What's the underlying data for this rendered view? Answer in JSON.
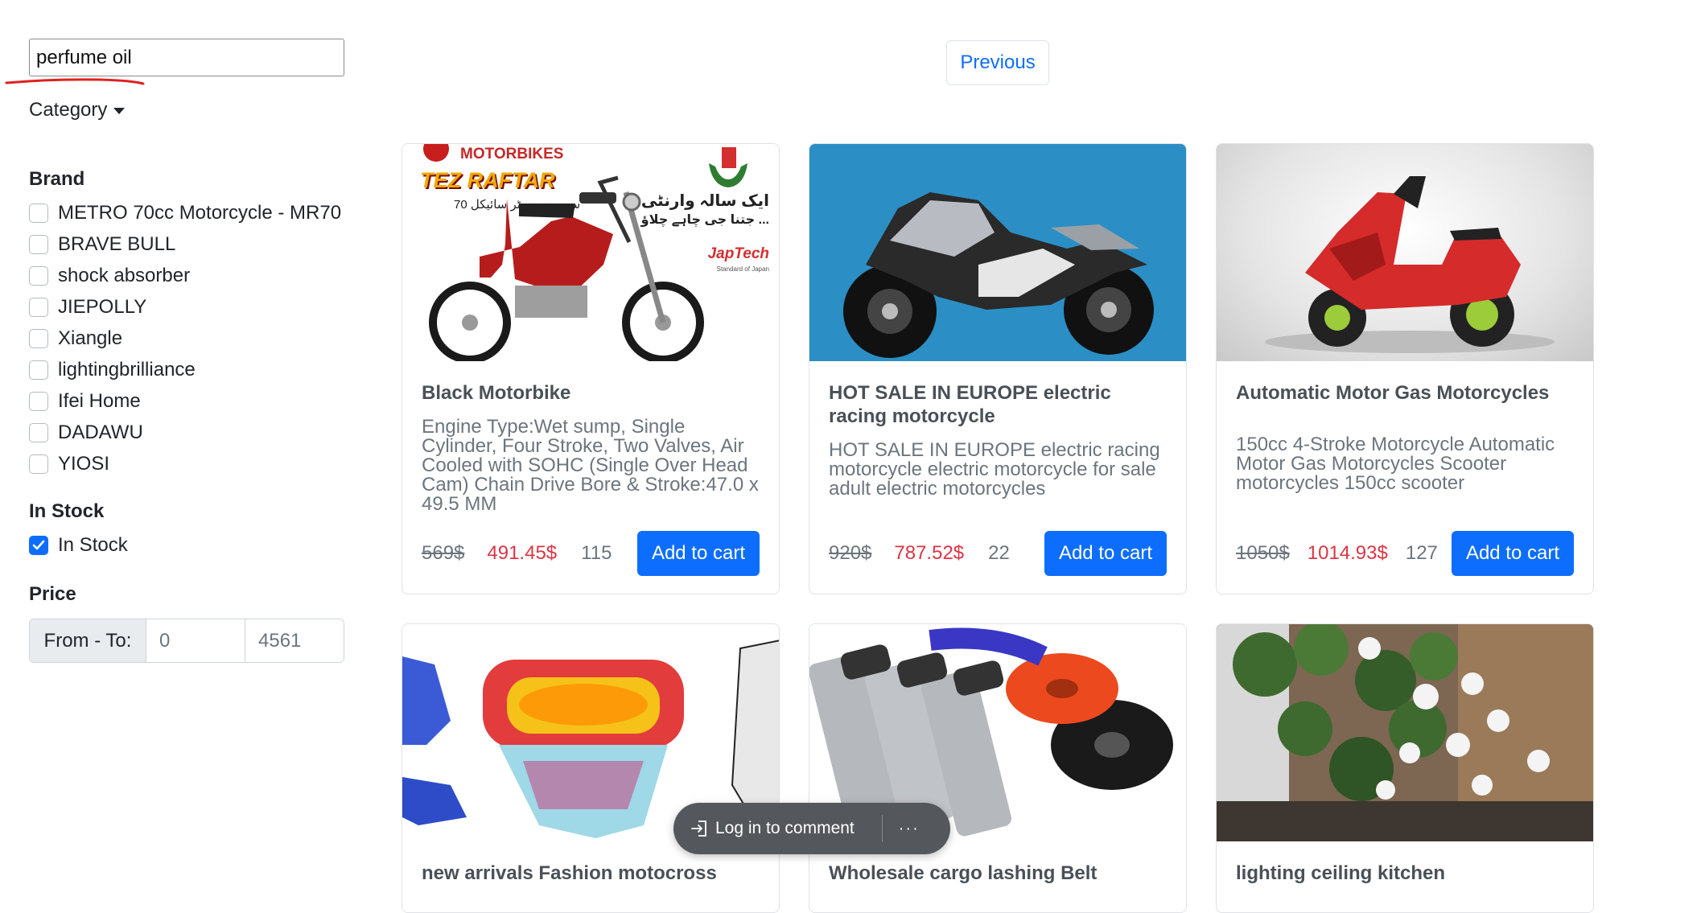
{
  "sidebar": {
    "search_value": "perfume oil",
    "category_label": "Category",
    "brand_title": "Brand",
    "brands": [
      "METRO 70cc Motorcycle - MR70",
      "BRAVE BULL",
      "shock absorber",
      "JIEPOLLY",
      "Xiangle",
      "lightingbrilliance",
      "Ifei Home",
      "DADAWU",
      "YIOSI"
    ],
    "stock_title": "In Stock",
    "stock_label": "In Stock",
    "stock_checked": true,
    "price_title": "Price",
    "price_label": "From - To:",
    "price_from": "0",
    "price_to": "4561"
  },
  "pagination": {
    "previous_label": "Previous"
  },
  "products": [
    {
      "title": "Black Motorbike",
      "description": "Engine Type:Wet sump, Single Cylinder, Four Stroke, Two Valves, Air Cooled with SOHC (Single Over Head Cam) Chain Drive Bore & Stroke:47.0 x 49.5 MM",
      "old_price": "569$",
      "new_price": "491.45$",
      "stock": "115",
      "button": "Add to cart",
      "image_text": {
        "brand": "MOTORBIKES",
        "model": "TEZ RAFTAR",
        "urdu_model": "70 سی سی موٹر سائیکل",
        "urdu_warranty": "ایک سالہ وارنٹی",
        "urdu_tagline": "جتنا جی چاہے چلاؤ ...",
        "logo": "JapTech",
        "logo_sub": "Standard of Japan"
      }
    },
    {
      "title": "HOT SALE IN EUROPE electric racing motorcycle",
      "description": "HOT SALE IN EUROPE electric racing motorcycle electric motorcycle for sale adult electric motorcycles",
      "old_price": "920$",
      "new_price": "787.52$",
      "stock": "22",
      "button": "Add to cart"
    },
    {
      "title": "Automatic Motor Gas Motorcycles",
      "description": "150cc 4-Stroke Motorcycle Automatic Motor Gas Motorcycles Scooter motorcycles 150cc scooter",
      "old_price": "1050$",
      "new_price": "1014.93$",
      "stock": "127",
      "button": "Add to cart"
    },
    {
      "title": "new arrivals Fashion motocross"
    },
    {
      "title": "Wholesale cargo lashing Belt"
    },
    {
      "title": "lighting ceiling kitchen"
    }
  ],
  "comment_bar": {
    "label": "Log in to comment",
    "more": "···"
  },
  "colors": {
    "primary": "#0d6efd",
    "sale_price": "#dc3545",
    "muted": "#6c757d",
    "annotation_underline": "#e02020"
  }
}
